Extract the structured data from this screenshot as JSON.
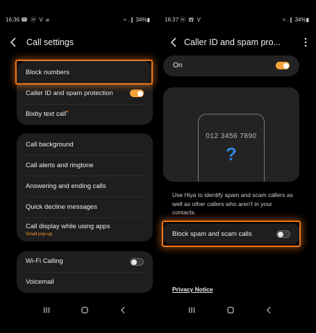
{
  "left": {
    "status": {
      "time": "16:36",
      "icons": "☎ ⓦ V ⌀",
      "right": "≈ .❙ 34%▮"
    },
    "title": "Call settings",
    "group1": [
      {
        "label": "Block numbers"
      },
      {
        "label": "Caller ID and spam protection",
        "toggle": "on"
      },
      {
        "label": "Bixby text call",
        "badge": "•"
      }
    ],
    "group2": [
      {
        "label": "Call background"
      },
      {
        "label": "Call alerts and ringtone"
      },
      {
        "label": "Answering and ending calls"
      },
      {
        "label": "Quick decline messages"
      },
      {
        "label": "Call display while using apps",
        "sub": "Small pop-up"
      }
    ],
    "group3": [
      {
        "label": "Wi-Fi Calling",
        "toggle": "off"
      },
      {
        "label": "Voicemail"
      }
    ]
  },
  "right": {
    "status": {
      "time": "16:37",
      "icons": "ⓦ ☎ V",
      "right": "≈ .❙ 34%▮"
    },
    "title": "Caller ID and spam pro...",
    "master_label": "On",
    "master_toggle": "on",
    "preview_number": "012 3456 7890",
    "preview_symbol": "?",
    "description": "Use Hiya to identify spam and scam callers as well as other callers who aren't in your contacts.",
    "spam_label": "Block spam and scam calls",
    "spam_toggle": "off",
    "privacy": "Privacy Notice"
  },
  "colors": {
    "accent": "#f5a23c",
    "highlight": "#f07a1a",
    "question": "#2f86e0",
    "sub": "#ff9a2e"
  },
  "icons": [
    "back-arrow-icon",
    "more-vertical-icon",
    "recent-apps-icon",
    "home-icon",
    "nav-back-icon"
  ]
}
